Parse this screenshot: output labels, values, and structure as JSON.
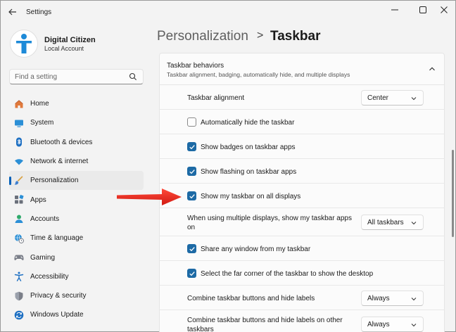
{
  "app": {
    "title": "Settings"
  },
  "profile": {
    "name": "Digital Citizen",
    "account": "Local Account"
  },
  "search": {
    "placeholder": "Find a setting"
  },
  "nav": [
    {
      "label": "Home",
      "icon": "home-icon",
      "active": false
    },
    {
      "label": "System",
      "icon": "system-icon",
      "active": false
    },
    {
      "label": "Bluetooth & devices",
      "icon": "bluetooth-icon",
      "active": false
    },
    {
      "label": "Network & internet",
      "icon": "wifi-icon",
      "active": false
    },
    {
      "label": "Personalization",
      "icon": "brush-icon",
      "active": true
    },
    {
      "label": "Apps",
      "icon": "apps-icon",
      "active": false
    },
    {
      "label": "Accounts",
      "icon": "accounts-icon",
      "active": false
    },
    {
      "label": "Time & language",
      "icon": "globe-clock-icon",
      "active": false
    },
    {
      "label": "Gaming",
      "icon": "gamepad-icon",
      "active": false
    },
    {
      "label": "Accessibility",
      "icon": "accessibility-icon",
      "active": false
    },
    {
      "label": "Privacy & security",
      "icon": "shield-icon",
      "active": false
    },
    {
      "label": "Windows Update",
      "icon": "update-icon",
      "active": false
    }
  ],
  "breadcrumb": {
    "parent": "Personalization",
    "separator": ">",
    "current": "Taskbar"
  },
  "group": {
    "title": "Taskbar behaviors",
    "subtitle": "Taskbar alignment, badging, automatically hide, and multiple displays"
  },
  "settings": {
    "alignment": {
      "label": "Taskbar alignment",
      "value": "Center"
    },
    "auto_hide": {
      "label": "Automatically hide the taskbar",
      "checked": false
    },
    "badges": {
      "label": "Show badges on taskbar apps",
      "checked": true
    },
    "flashing": {
      "label": "Show flashing on taskbar apps",
      "checked": true
    },
    "all_displays": {
      "label": "Show my taskbar on all displays",
      "checked": true
    },
    "multi_display": {
      "label_line1": "When using multiple displays, show my taskbar apps",
      "label_line2": "on",
      "value": "All taskbars"
    },
    "share_window": {
      "label": "Share any window from my taskbar",
      "checked": true
    },
    "far_corner": {
      "label": "Select the far corner of the taskbar to show the desktop",
      "checked": true
    },
    "combine": {
      "label": "Combine taskbar buttons and hide labels",
      "value": "Always"
    },
    "combine_other": {
      "label_line1": "Combine taskbar buttons and hide labels on other",
      "label_line2": "taskbars",
      "value": "Always"
    }
  },
  "colors": {
    "accent": "#1d6aa5",
    "annotation_arrow": "#e8221b",
    "nav_indicator": "#005fb8"
  }
}
